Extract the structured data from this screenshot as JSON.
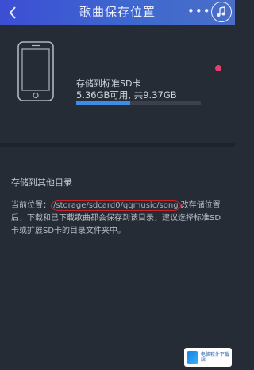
{
  "header": {
    "title": "歌曲保存位置",
    "back_icon": "chevron-left-icon",
    "more_label": "•••",
    "music_icon": "music-note-icon"
  },
  "storage": {
    "label": "存储到标准SD卡",
    "size_text": "5.36GB可用, 共9.37GB",
    "used_fraction": 0.43,
    "selected": true
  },
  "other": {
    "section_title": "存储到其他目录",
    "desc_prefix": "当前位置：",
    "path": "/storage/sdcard0/qqmusic/song",
    "desc_suffix": "改存储位置后，下载和已下载歌曲都会保存到该目录，建议选择标准SD卡或扩展SD卡的目录文件夹中。"
  },
  "watermark": {
    "text": "电脑软件下载站"
  },
  "colors": {
    "header_start": "#3c4ed4",
    "header_end": "#4a6ec8",
    "background": "#262c35",
    "progress": "#3f8be8",
    "selected_dot": "#e0406b",
    "highlight": "#c8262c"
  }
}
